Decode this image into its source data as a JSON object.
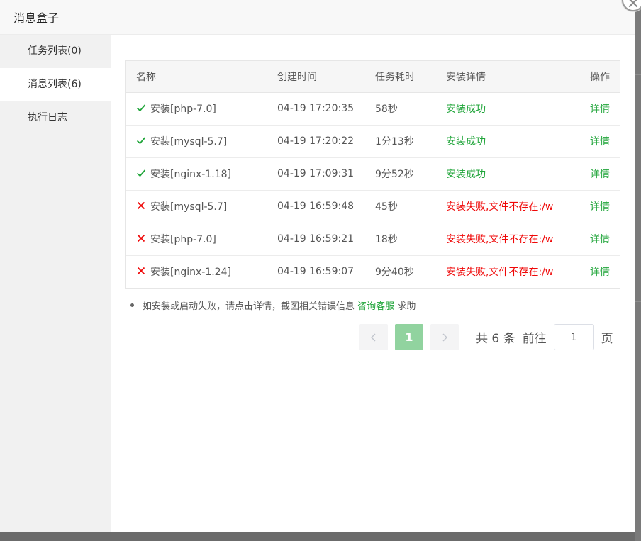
{
  "dialog": {
    "title": "消息盒子"
  },
  "sidebar": {
    "items": [
      {
        "label": "任务列表(0)",
        "active": false
      },
      {
        "label": "消息列表(6)",
        "active": true
      },
      {
        "label": "执行日志",
        "active": false
      }
    ]
  },
  "table": {
    "headers": {
      "name": "名称",
      "time": "创建时间",
      "duration": "任务耗时",
      "detail": "安装详情",
      "op": "操作"
    },
    "rows": [
      {
        "status": "success",
        "name": "安装[php-7.0]",
        "time": "04-19 17:20:35",
        "duration": "58秒",
        "detail": "安装成功",
        "op": "详情"
      },
      {
        "status": "success",
        "name": "安装[mysql-5.7]",
        "time": "04-19 17:20:22",
        "duration": "1分13秒",
        "detail": "安装成功",
        "op": "详情"
      },
      {
        "status": "success",
        "name": "安装[nginx-1.18]",
        "time": "04-19 17:09:31",
        "duration": "9分52秒",
        "detail": "安装成功",
        "op": "详情"
      },
      {
        "status": "fail",
        "name": "安装[mysql-5.7]",
        "time": "04-19 16:59:48",
        "duration": "45秒",
        "detail": "安装失败,文件不存在:/w",
        "op": "详情"
      },
      {
        "status": "fail",
        "name": "安装[php-7.0]",
        "time": "04-19 16:59:21",
        "duration": "18秒",
        "detail": "安装失败,文件不存在:/w",
        "op": "详情"
      },
      {
        "status": "fail",
        "name": "安装[nginx-1.24]",
        "time": "04-19 16:59:07",
        "duration": "9分40秒",
        "detail": "安装失败,文件不存在:/w",
        "op": "详情"
      }
    ]
  },
  "tip": {
    "text": "如安装或启动失败，请点击详情，截图相关错误信息",
    "link": "咨询客服",
    "suffix": "求助"
  },
  "pagination": {
    "prev_icon": "chevron-left-icon",
    "next_icon": "chevron-right-icon",
    "current_page": "1",
    "total": "共 6 条",
    "goto": "前往",
    "goto_value": "1",
    "unit": "页"
  },
  "colors": {
    "success": "#20a53a",
    "fail": "#ef0808",
    "active_page": "#91d39f"
  }
}
